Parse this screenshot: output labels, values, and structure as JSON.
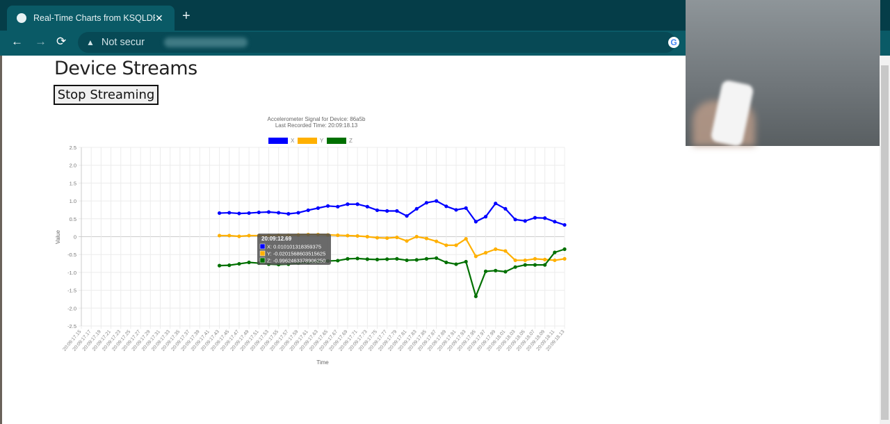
{
  "browser": {
    "tab_title": "Real-Time Charts from KSQLDB a",
    "new_tab": "+",
    "close": "✕",
    "security": "Not secur",
    "back": "←",
    "forward": "→",
    "reload": "⟳",
    "google": "G"
  },
  "page": {
    "title": "Device Streams",
    "stop_button": "Stop Streaming"
  },
  "chart_data": {
    "type": "line",
    "title": [
      "Accelerometer Signal for Device: 86a5b",
      "Last Recorded Time:  20:09:18.13"
    ],
    "xlabel": "Time",
    "ylabel": "Value",
    "ylim": [
      -2.5,
      2.5
    ],
    "yticks": [
      "2.5",
      "2.0",
      "1.5",
      "1.0",
      "0.5",
      "0",
      "-0.5",
      "-1.0",
      "-1.5",
      "-2.0",
      "-2.5"
    ],
    "categories": [
      "20:09:17.15",
      "20:09:17.17",
      "20:09:17.19",
      "20:09:17.21",
      "20:09:17.23",
      "20:09:17.25",
      "20:09:17.27",
      "20:09:17.29",
      "20:09:17.31",
      "20:09:17.33",
      "20:09:17.35",
      "20:09:17.37",
      "20:09:17.39",
      "20:09:17.41",
      "20:09:17.43",
      "20:09:17.45",
      "20:09:17.47",
      "20:09:17.49",
      "20:09:17.51",
      "20:09:17.53",
      "20:09:17.55",
      "20:09:17.57",
      "20:09:17.59",
      "20:09:17.61",
      "20:09:17.63",
      "20:09:17.65",
      "20:09:17.67",
      "20:09:17.69",
      "20:09:17.71",
      "20:09:17.73",
      "20:09:17.75",
      "20:09:17.77",
      "20:09:17.79",
      "20:09:17.81",
      "20:09:17.83",
      "20:09:17.85",
      "20:09:17.87",
      "20:09:17.89",
      "20:09:17.91",
      "20:09:17.93",
      "20:09:17.95",
      "20:09:17.97",
      "20:09:17.99",
      "20:09:18.01",
      "20:09:18.03",
      "20:09:18.05",
      "20:09:18.07",
      "20:09:18.09",
      "20:09:18.11",
      "20:09:18.13"
    ],
    "data_start_index": 14,
    "grid": true,
    "legend": "top",
    "series": [
      {
        "name": "X",
        "color": "#0000ff",
        "values": [
          0.66,
          0.67,
          0.65,
          0.66,
          0.68,
          0.69,
          0.67,
          0.64,
          0.67,
          0.74,
          0.8,
          0.86,
          0.84,
          0.91,
          0.91,
          0.84,
          0.74,
          0.72,
          0.72,
          0.58,
          0.78,
          0.95,
          1.0,
          0.85,
          0.75,
          0.8,
          0.42,
          0.56,
          0.93,
          0.78,
          0.48,
          0.44,
          0.53,
          0.52,
          0.42,
          0.33
        ]
      },
      {
        "name": "Y",
        "color": "#ffb000",
        "values": [
          0.03,
          0.03,
          0.01,
          0.03,
          0.03,
          0.03,
          0.04,
          0.04,
          0.05,
          0.06,
          0.06,
          0.05,
          0.04,
          0.03,
          0.02,
          0.0,
          -0.03,
          -0.04,
          -0.02,
          -0.12,
          0.0,
          -0.05,
          -0.13,
          -0.24,
          -0.24,
          -0.06,
          -0.55,
          -0.45,
          -0.35,
          -0.4,
          -0.66,
          -0.66,
          -0.62,
          -0.64,
          -0.66,
          -0.62
        ]
      },
      {
        "name": "Z",
        "color": "#007000",
        "values": [
          -0.81,
          -0.8,
          -0.76,
          -0.72,
          -0.74,
          -0.77,
          -0.78,
          -0.77,
          -0.74,
          -0.72,
          -0.7,
          -0.68,
          -0.67,
          -0.62,
          -0.61,
          -0.63,
          -0.64,
          -0.63,
          -0.62,
          -0.66,
          -0.65,
          -0.62,
          -0.6,
          -0.72,
          -0.77,
          -0.7,
          -1.67,
          -0.97,
          -0.95,
          -0.98,
          -0.85,
          -0.79,
          -0.79,
          -0.79,
          -0.44,
          -0.35
        ]
      }
    ],
    "tooltip": {
      "title": "20:09:12.69",
      "lines": [
        "X: 0.010101318359375",
        "Y: -0.0201568603515625",
        "Z: -0.9962463378906250"
      ]
    }
  }
}
